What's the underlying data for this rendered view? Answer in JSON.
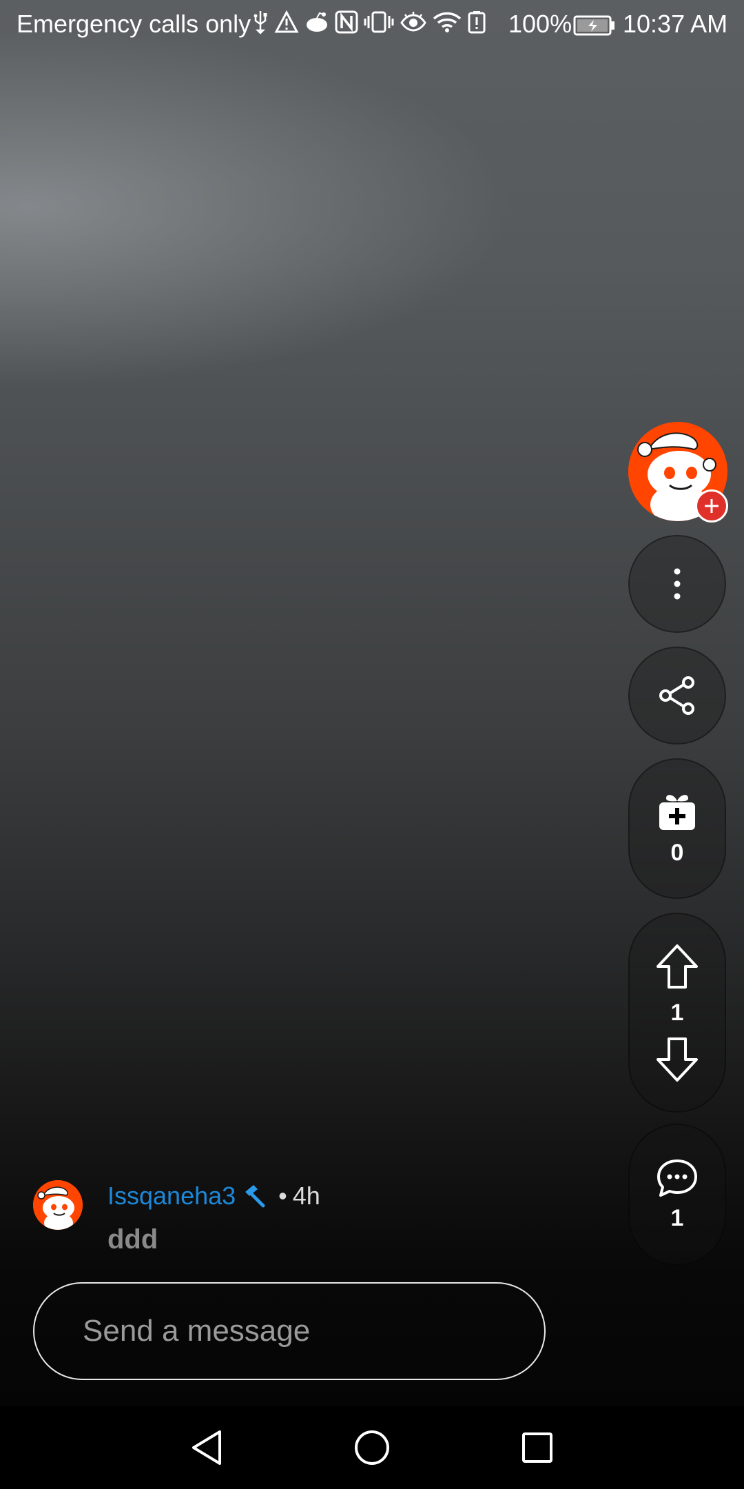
{
  "status_bar": {
    "carrier_text": "Emergency calls only",
    "battery_percent": "100%",
    "time": "10:37 AM",
    "icons": [
      "usb-icon",
      "warning-icon",
      "reddit-notification-icon",
      "nfc-icon",
      "vibrate-icon",
      "eye-comfort-icon",
      "wifi-icon",
      "battery-alert-icon",
      "battery-charging-icon"
    ]
  },
  "rail": {
    "award_count": "0",
    "vote_count": "1",
    "comment_count": "1"
  },
  "comment": {
    "username": "Issqaneha3",
    "separator": "•",
    "age": "4h",
    "text": "ddd"
  },
  "composer": {
    "placeholder": "Send a message"
  },
  "colors": {
    "accent_orange": "#ff4500",
    "username_blue": "#1e88d8",
    "follow_red": "#e0302a"
  }
}
